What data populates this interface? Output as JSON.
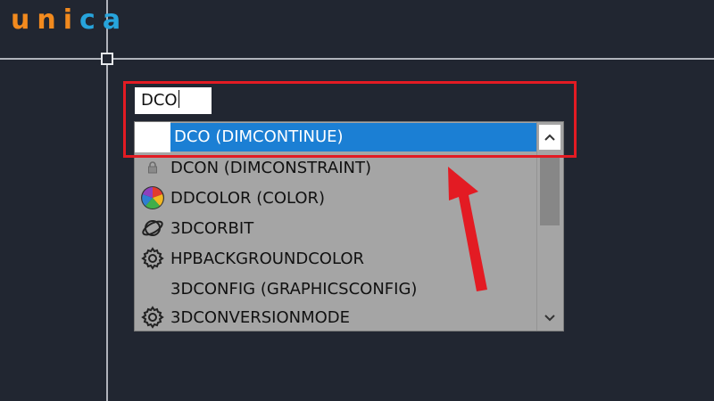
{
  "brand": {
    "logo_letters": [
      "u",
      "n",
      "i",
      "c",
      "a"
    ],
    "colors": {
      "orange": "#f28a1e",
      "blue": "#27a4dc"
    }
  },
  "command_line": {
    "input_value": "DCO"
  },
  "autocomplete": {
    "items": [
      {
        "label": "DCO (DIMCONTINUE)",
        "icon": "blank-icon",
        "selected": true
      },
      {
        "label": "DCON (DIMCONSTRAINT)",
        "icon": "lock-icon",
        "selected": false
      },
      {
        "label": "DDCOLOR (COLOR)",
        "icon": "color-wheel-icon",
        "selected": false
      },
      {
        "label": "3DCORBIT",
        "icon": "orbit-icon",
        "selected": false
      },
      {
        "label": "HPBACKGROUNDCOLOR",
        "icon": "gear-icon",
        "selected": false
      },
      {
        "label": "3DCONFIG (GRAPHICSCONFIG)",
        "icon": "blank-icon",
        "selected": false
      },
      {
        "label": "3DCONVERSIONMODE",
        "icon": "gear-icon",
        "selected": false
      }
    ],
    "scroll_up_icon": "chevron-up-icon",
    "scroll_down_icon": "chevron-down-icon"
  },
  "colors": {
    "canvas_bg": "#212631",
    "selection": "#1b7fd4",
    "highlight": "#e31b23"
  }
}
